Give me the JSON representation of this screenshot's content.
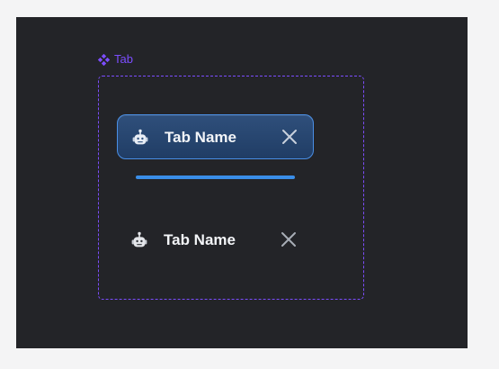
{
  "component": {
    "label": "Tab",
    "icon": "component-diamond-icon",
    "accent_color": "#7c4dff"
  },
  "tabs": [
    {
      "label": "Tab Name",
      "state": "selected",
      "icon": "robot-icon",
      "close_icon": "close-icon",
      "background_color": "#263f63",
      "border_color": "#4a8fe5"
    },
    {
      "label": "Tab Name",
      "state": "unselected",
      "icon": "robot-icon",
      "close_icon": "close-icon"
    }
  ],
  "colors": {
    "canvas": "#232428",
    "page": "#f4f4f5",
    "selected_indicator": "#3a8ee8"
  }
}
